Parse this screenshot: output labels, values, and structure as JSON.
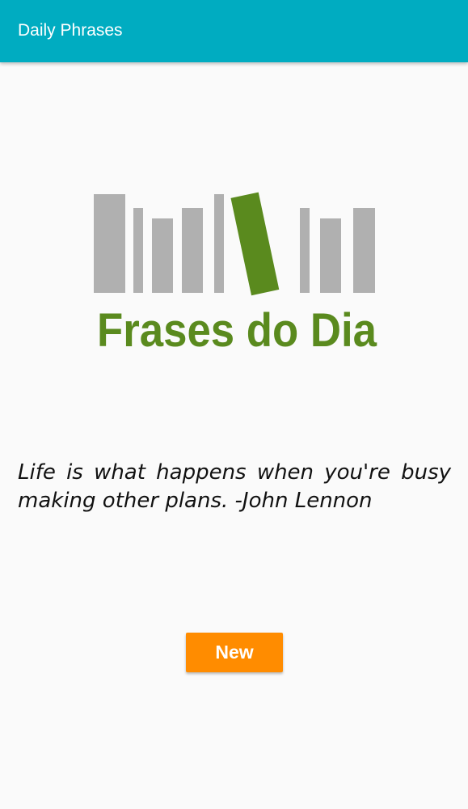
{
  "app_bar": {
    "title": "Daily Phrases",
    "background_color": "#00acc1"
  },
  "logo": {
    "text": "Frases do Dia",
    "bar_color": "#b0b0b0",
    "accent_color": "#5a8a1e"
  },
  "quote": {
    "text": "Life is what happens when you're busy making other plans. -John Lennon"
  },
  "new_button": {
    "label": "New",
    "color": "#ff8c00"
  }
}
